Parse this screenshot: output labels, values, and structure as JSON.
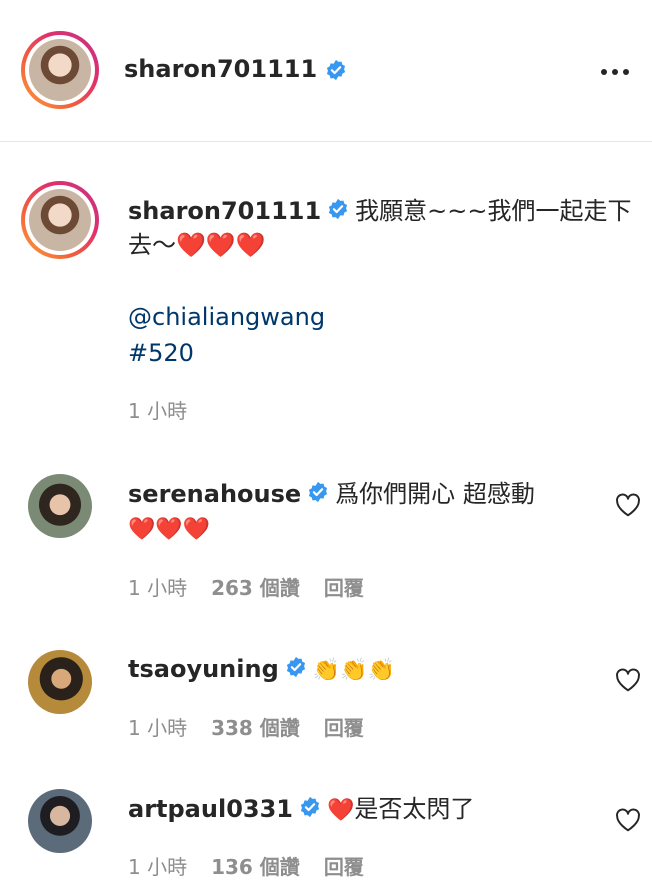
{
  "header": {
    "username": "sharon701111"
  },
  "caption": {
    "username": "sharon701111",
    "text": "我願意~~~我們一起走下去～❤️❤️❤️",
    "mention": "@chialiangwang",
    "hashtag": "#520",
    "time": "1 小時"
  },
  "comments": [
    {
      "username": "serenahouse",
      "text": "爲你們開心 超感動",
      "emoji": "❤️❤️❤️",
      "time": "1 小時",
      "likes": "263 個讚",
      "reply": "回覆"
    },
    {
      "username": "tsaoyuning",
      "text": "",
      "emoji": "👏👏👏",
      "time": "1 小時",
      "likes": "338 個讚",
      "reply": "回覆"
    },
    {
      "username": "artpaul0331",
      "text": "是否太閃了",
      "emoji": "❤️",
      "time": "1 小時",
      "likes": "136 個讚",
      "reply": "回覆"
    }
  ],
  "icons": {
    "verified": "verified-badge-icon",
    "more": "more-options-icon",
    "like": "heart-outline-icon"
  },
  "colors": {
    "verified": "#3897f0",
    "link": "#00376b",
    "secondary_text": "#8e8e8e",
    "divider": "#e6e6e6"
  }
}
